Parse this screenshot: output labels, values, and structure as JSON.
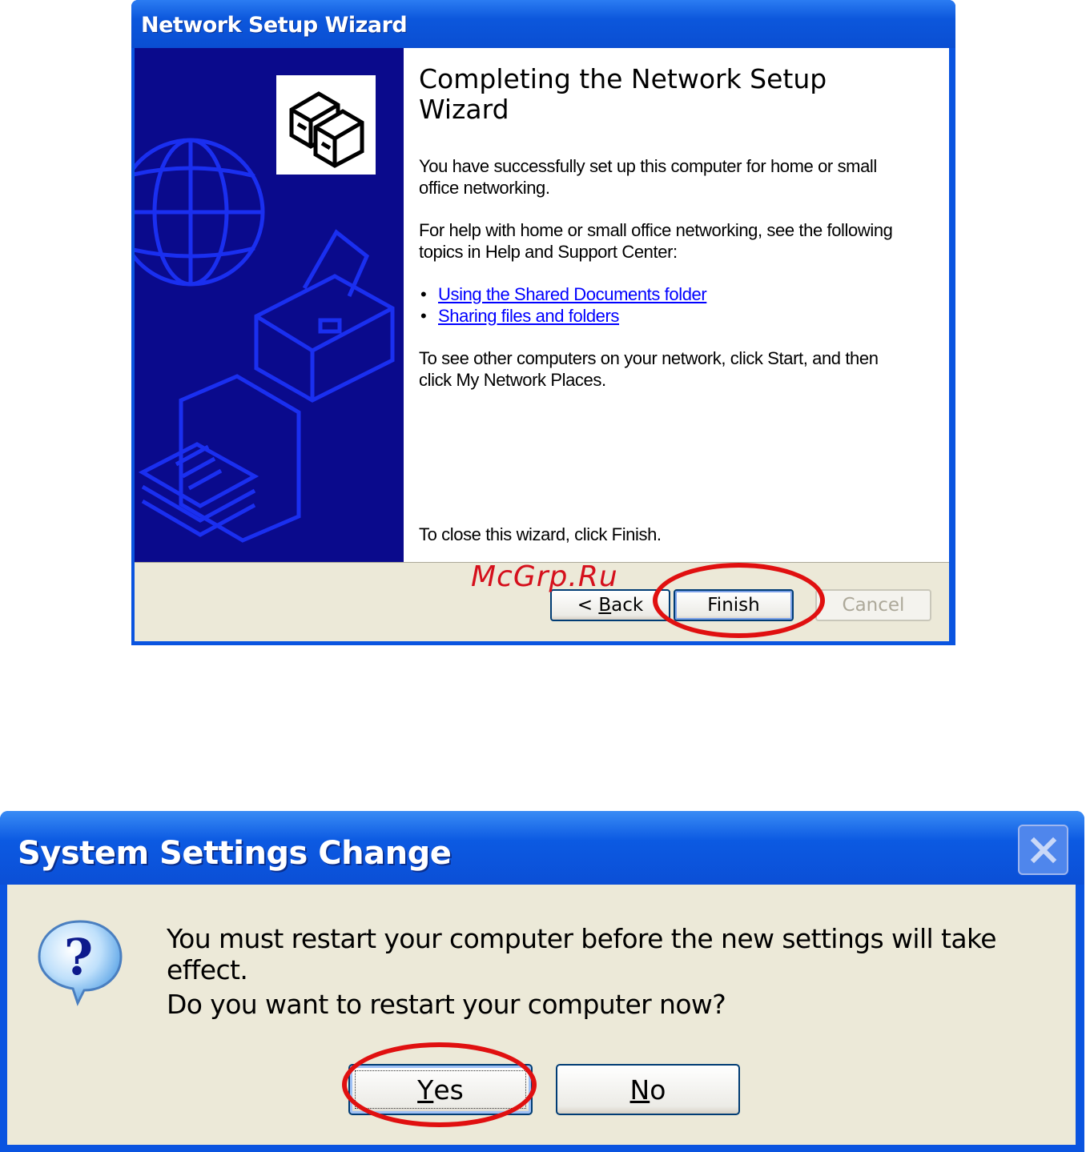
{
  "wizard": {
    "title": "Network Setup Wizard",
    "heading": "Completing the Network Setup Wizard",
    "success_text": "You have successfully set up this computer for home or small office networking.",
    "help_text": "For help with home or small office networking, see the following topics in Help and Support Center:",
    "links": [
      "Using the Shared Documents folder",
      "Sharing files and folders"
    ],
    "bullet": "•",
    "see_others_text": "To see other computers on your network, click Start, and then click My Network Places.",
    "close_text": "To close this wizard, click Finish.",
    "buttons": {
      "back_prefix": "< ",
      "back_mnemonic": "B",
      "back_rest": "ack",
      "finish": "Finish",
      "cancel": "Cancel"
    }
  },
  "watermark": "McGrp.Ru",
  "dialog": {
    "title": "System Settings Change",
    "message": "You must restart your computer before the new settings will take effect.",
    "question": "Do you want to restart your computer now?",
    "buttons": {
      "yes_mnemonic": "Y",
      "yes_rest": "es",
      "no_mnemonic": "N",
      "no_rest": "o"
    }
  },
  "colors": {
    "highlight": "#e01010",
    "xp_blue": "#0a54e0",
    "banner_navy": "#0a0a8c",
    "link": "#0000ff"
  },
  "icons": {
    "emblem": "network-computers-icon",
    "question": "question-balloon-icon",
    "close": "close-icon"
  }
}
